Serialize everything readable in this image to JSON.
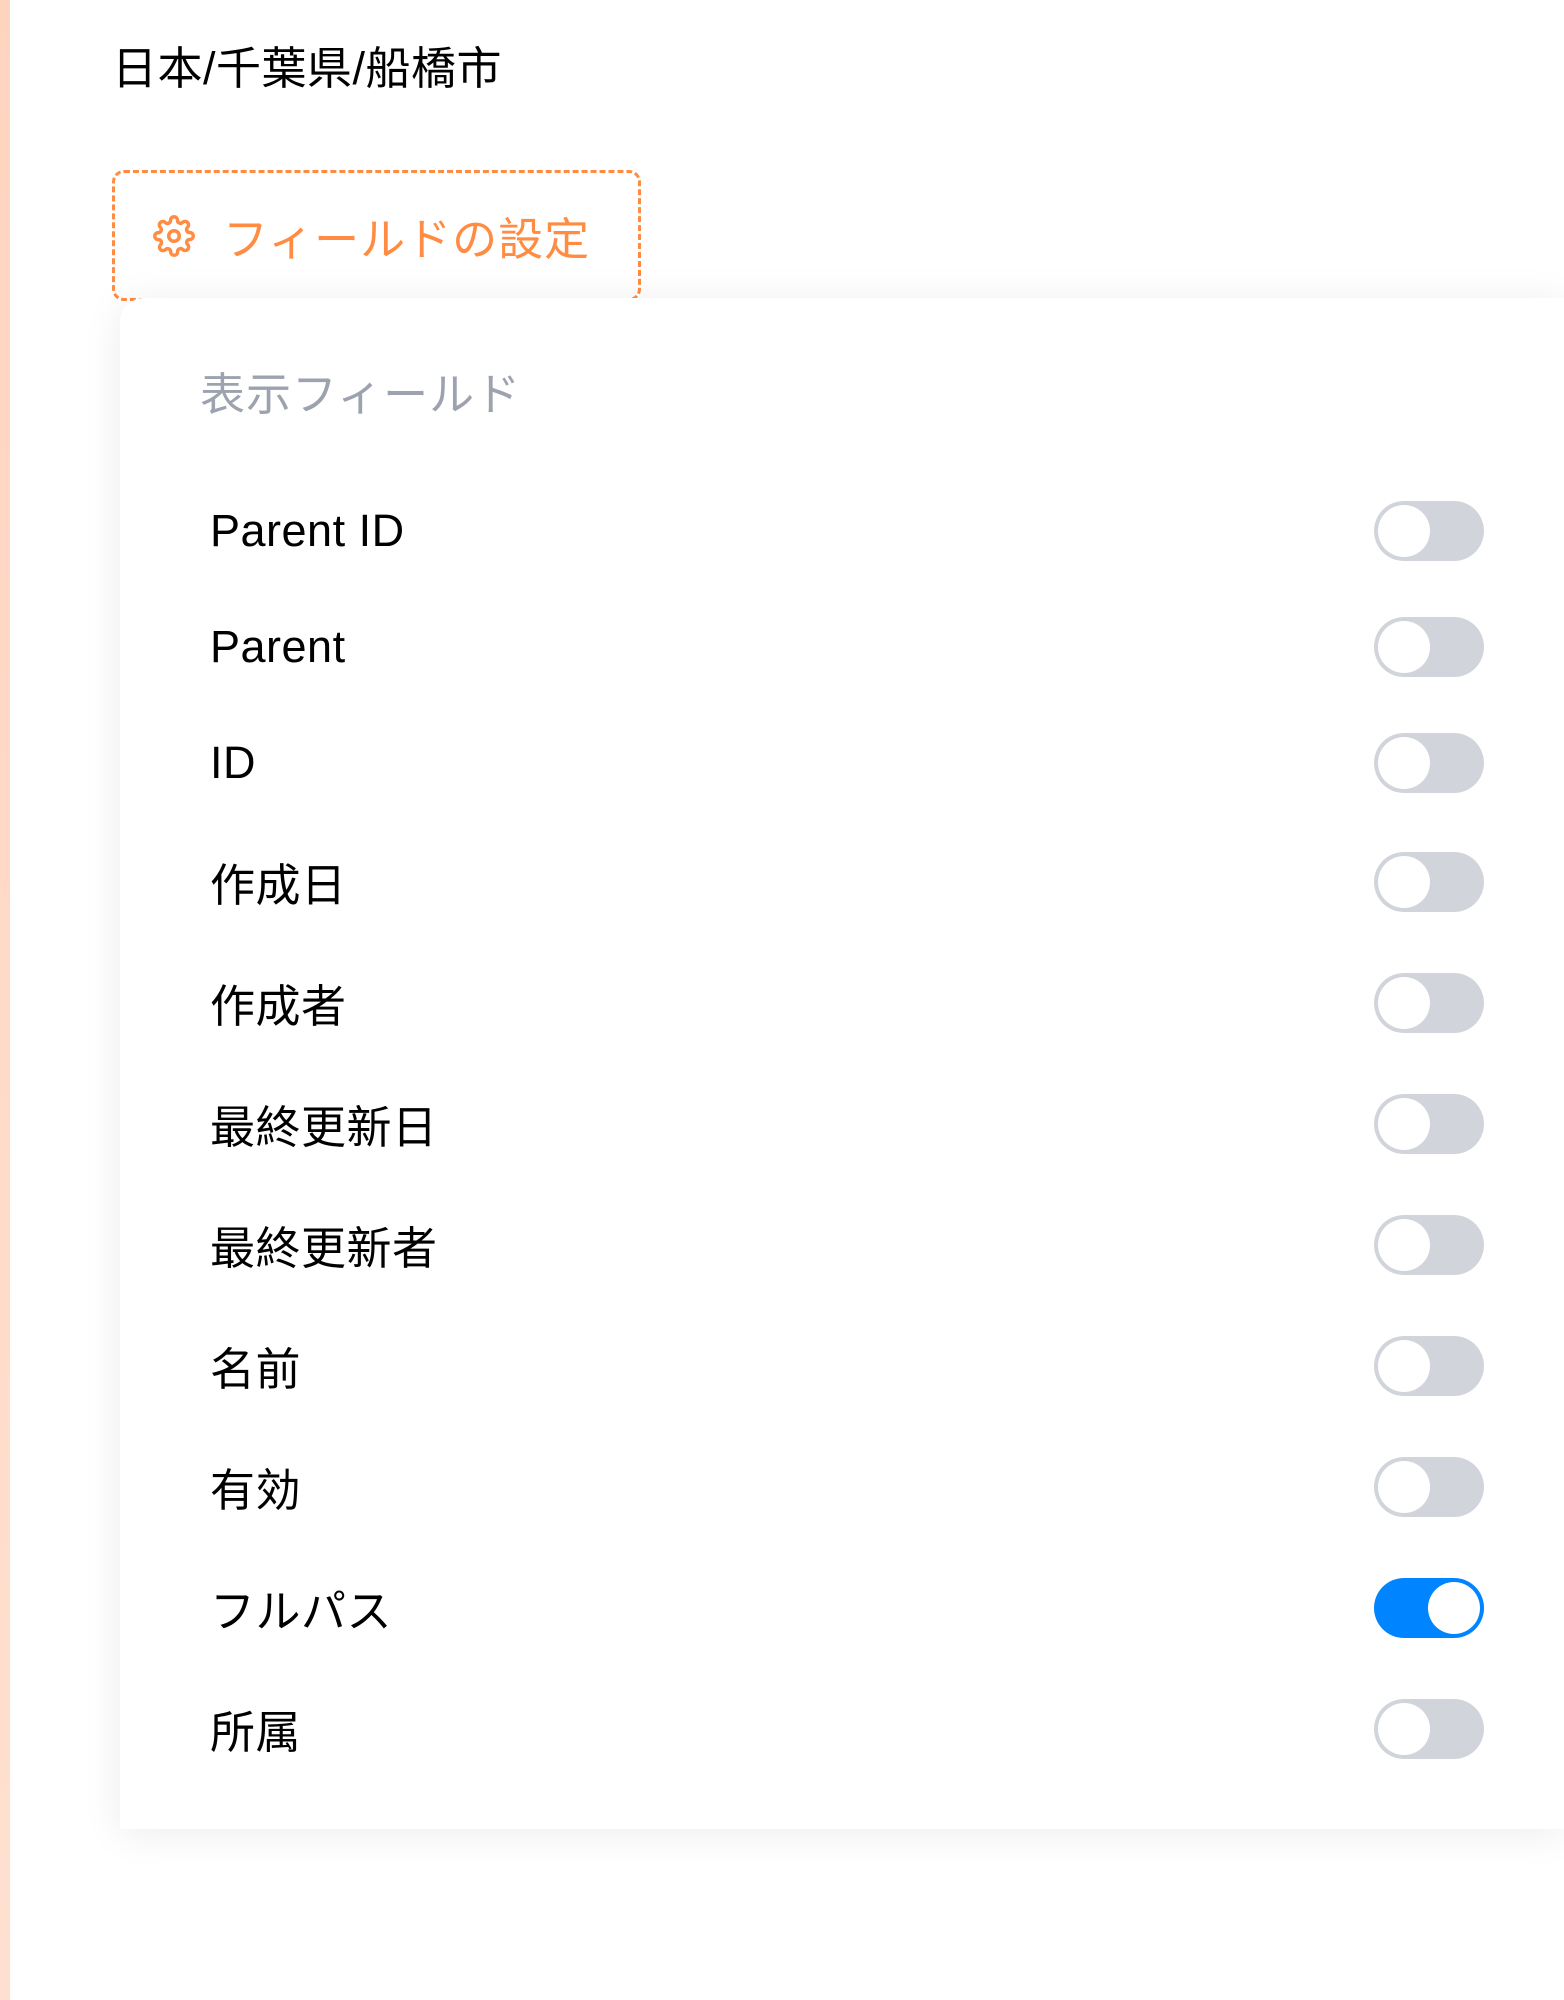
{
  "breadcrumb": "日本/千葉県/船橋市",
  "field_settings_button": {
    "label": "フィールドの設定"
  },
  "panel": {
    "header": "表示フィールド",
    "fields": [
      {
        "label": "Parent ID",
        "enabled": false
      },
      {
        "label": "Parent",
        "enabled": false
      },
      {
        "label": "ID",
        "enabled": false
      },
      {
        "label": "作成日",
        "enabled": false
      },
      {
        "label": "作成者",
        "enabled": false
      },
      {
        "label": "最終更新日",
        "enabled": false
      },
      {
        "label": "最終更新者",
        "enabled": false
      },
      {
        "label": "名前",
        "enabled": false
      },
      {
        "label": "有効",
        "enabled": false
      },
      {
        "label": "フルパス",
        "enabled": true
      },
      {
        "label": "所属",
        "enabled": false
      }
    ]
  },
  "colors": {
    "accent_orange": "#ff8c42",
    "toggle_on": "#0084ff",
    "toggle_off": "#d1d5db"
  }
}
